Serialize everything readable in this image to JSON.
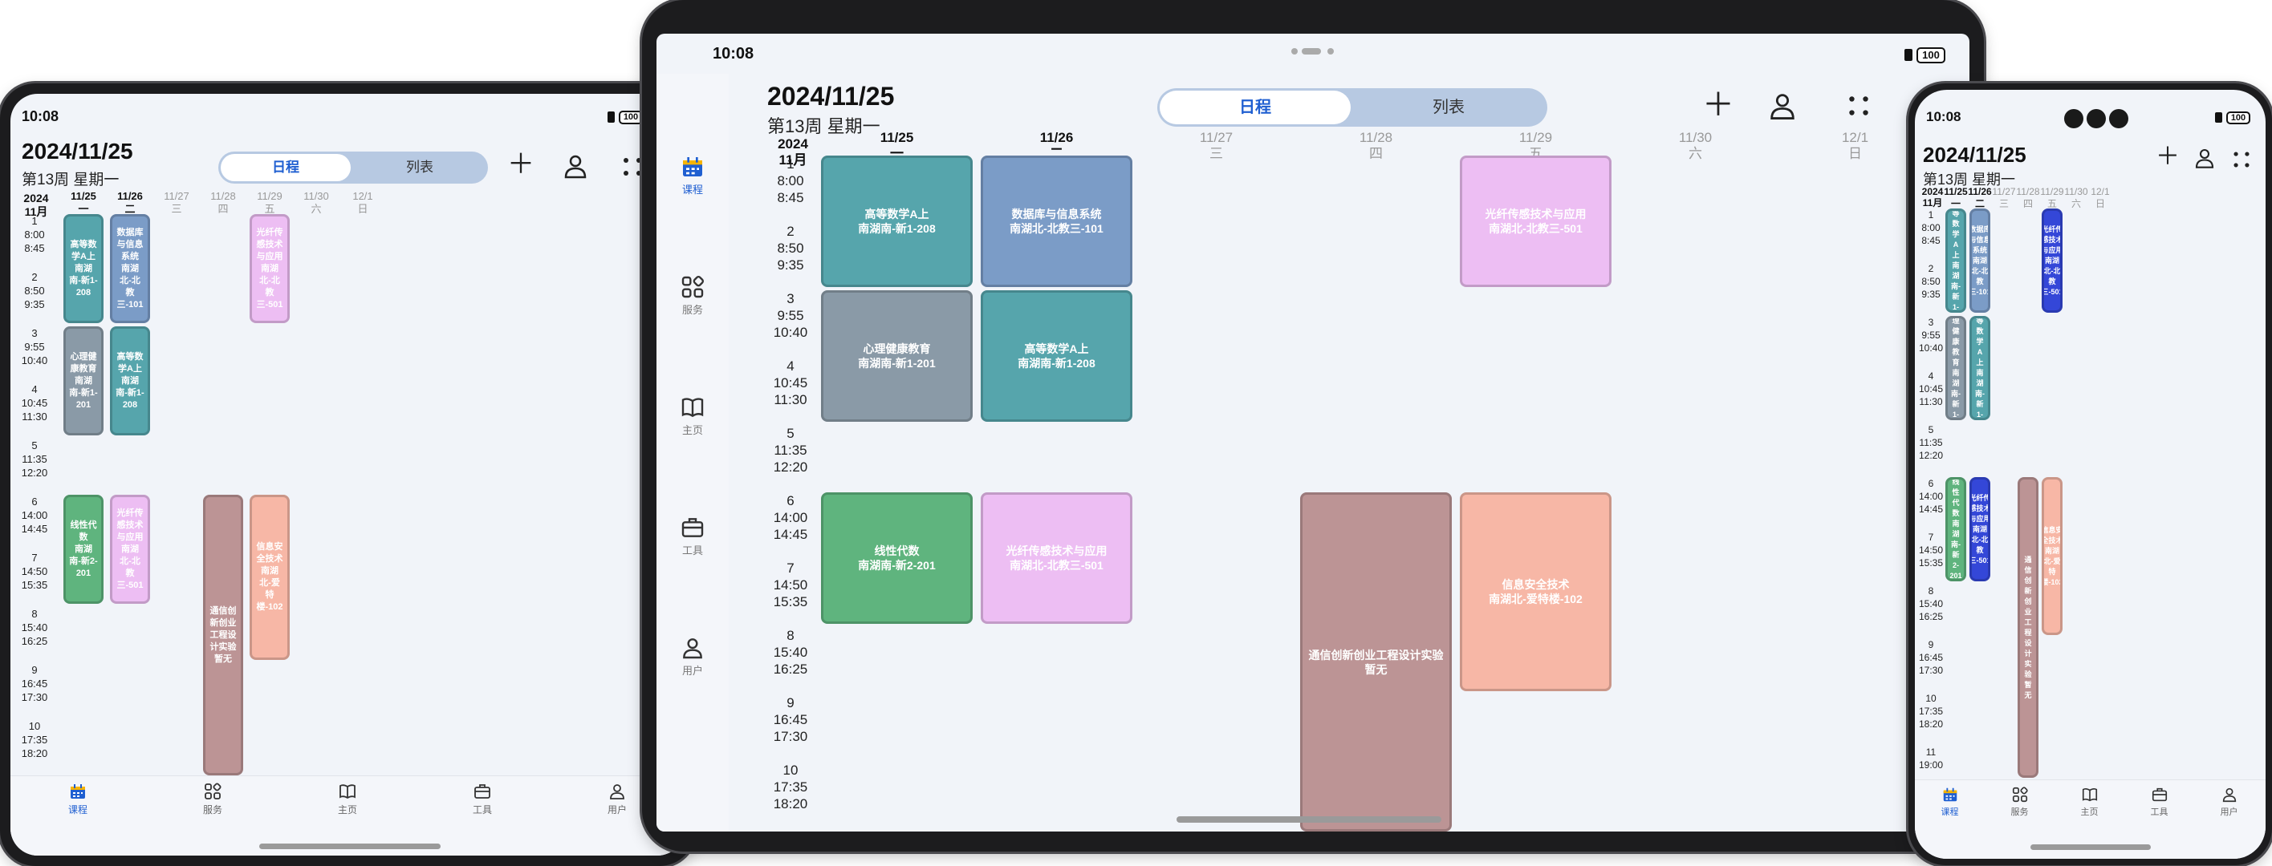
{
  "status": {
    "time": "10:08",
    "battery": "100"
  },
  "header": {
    "date": "2024/11/25",
    "week_label": "第13周 星期一",
    "seg_schedule": "日程",
    "seg_list": "列表",
    "add_icon": "＋",
    "person_icon": "user-icon",
    "more_icon": "grid-dots-icon"
  },
  "calendar": {
    "month_top": "2024",
    "month_bottom": "11月",
    "days": [
      {
        "date": "11/25",
        "weekday": "一"
      },
      {
        "date": "11/26",
        "weekday": "二"
      },
      {
        "date": "11/27",
        "weekday": "三"
      },
      {
        "date": "11/28",
        "weekday": "四"
      },
      {
        "date": "11/29",
        "weekday": "五"
      },
      {
        "date": "11/30",
        "weekday": "六"
      },
      {
        "date": "12/1",
        "weekday": "日"
      }
    ],
    "periods": [
      {
        "n": "1",
        "start": "8:00",
        "end": "8:45"
      },
      {
        "n": "2",
        "start": "8:50",
        "end": "9:35"
      },
      {
        "n": "3",
        "start": "9:55",
        "end": "10:40"
      },
      {
        "n": "4",
        "start": "10:45",
        "end": "11:30"
      },
      {
        "n": "5",
        "start": "11:35",
        "end": "12:20"
      },
      {
        "n": "6",
        "start": "14:00",
        "end": "14:45"
      },
      {
        "n": "7",
        "start": "14:50",
        "end": "15:35"
      },
      {
        "n": "8",
        "start": "15:40",
        "end": "16:25"
      },
      {
        "n": "9",
        "start": "16:45",
        "end": "17:30"
      },
      {
        "n": "10",
        "start": "17:35",
        "end": "18:20"
      },
      {
        "n": "11",
        "start": "19:00",
        "end": ""
      }
    ],
    "courses": {
      "math_mon": {
        "name": "高等数学A上",
        "room": "南湖南-新1-208"
      },
      "db_tue": {
        "name": "数据库与信息系统",
        "room": "南湖北-北教三-101"
      },
      "fiber_fri": {
        "name": "光纤传感技术与应用",
        "room": "南湖北-北教三-501"
      },
      "psy_mon": {
        "name": "心理健康教育",
        "room": "南湖南-新1-201"
      },
      "math_tue": {
        "name": "高等数学A上",
        "room": "南湖南-新1-208"
      },
      "linalg_mon": {
        "name": "线性代数",
        "room": "南湖南-新2-201"
      },
      "fiber_tue": {
        "name": "光纤传感技术与应用",
        "room": "南湖北-北教三-501"
      },
      "comm_thu": {
        "name": "通信创新创业工程设计实验",
        "room": "暂无"
      },
      "infosec_fri": {
        "name": "信息安全技术",
        "room": "南湖北-爱特楼-102"
      }
    }
  },
  "tabs": [
    {
      "label": "课程",
      "icon": "calendar-icon"
    },
    {
      "label": "服务",
      "icon": "apps-icon"
    },
    {
      "label": "主页",
      "icon": "book-icon"
    },
    {
      "label": "工具",
      "icon": "briefcase-icon"
    },
    {
      "label": "用户",
      "icon": "user-icon"
    }
  ]
}
